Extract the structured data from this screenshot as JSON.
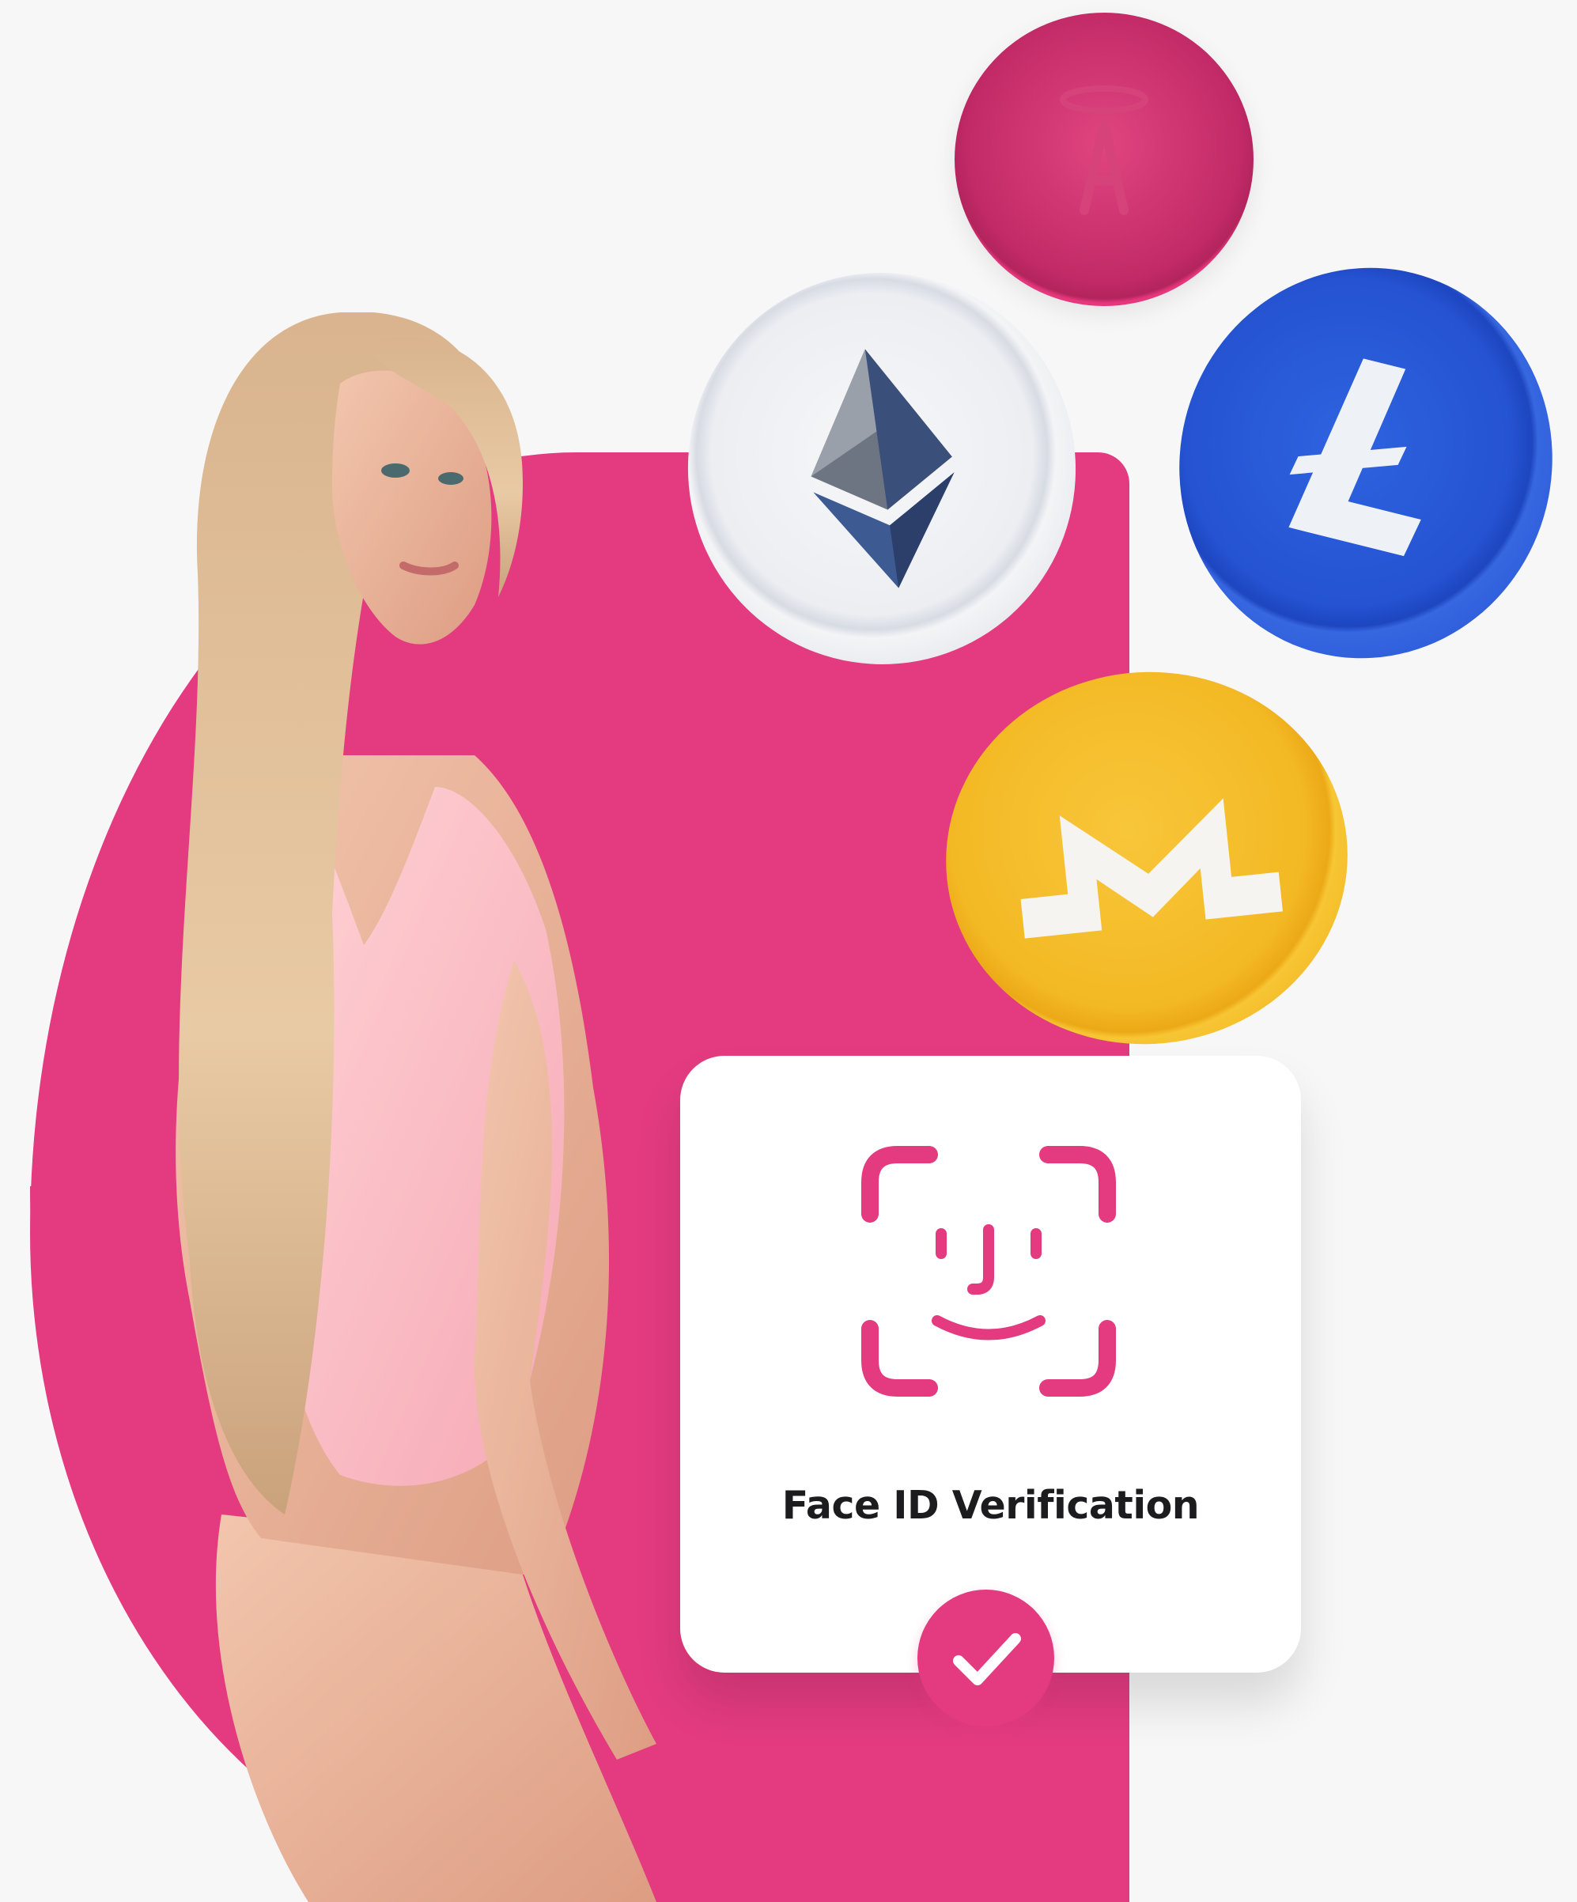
{
  "card": {
    "title": "Face ID Verification"
  },
  "icons": {
    "face_id": "face-id-icon",
    "check": "checkmark-icon",
    "coins": [
      "angel-coin-icon",
      "ethereum-coin-icon",
      "litecoin-coin-icon",
      "monero-coin-icon"
    ]
  },
  "colors": {
    "accent": "#e43b80",
    "background": "#f7f7f8",
    "card": "#ffffff"
  }
}
